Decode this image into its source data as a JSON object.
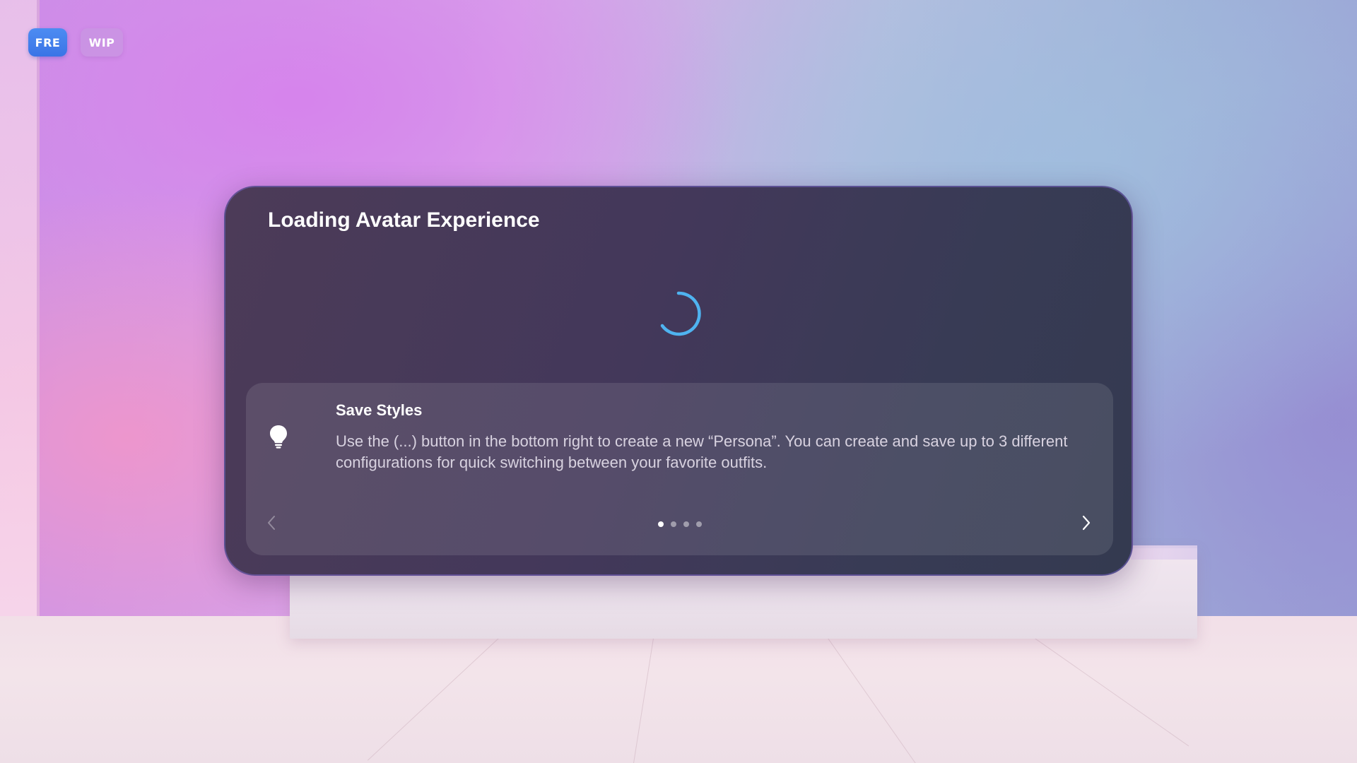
{
  "badges": {
    "fre_label": "FRE",
    "wip_label": "WIP",
    "fre_color": "#3a74e6"
  },
  "dialog": {
    "title": "Loading Avatar Experience",
    "spinner_icon": "loading-spinner-icon",
    "accent_color": "#4fb3f0"
  },
  "tip": {
    "icon": "lightbulb-icon",
    "title": "Save Styles",
    "body": "Use the (...) button in the bottom right to create a new “Persona”. You can create and save up to 3 different configurations for quick switching between your favorite outfits.",
    "prev_icon": "chevron-left-icon",
    "next_icon": "chevron-right-icon",
    "page_count": 4,
    "current_page": 1
  }
}
